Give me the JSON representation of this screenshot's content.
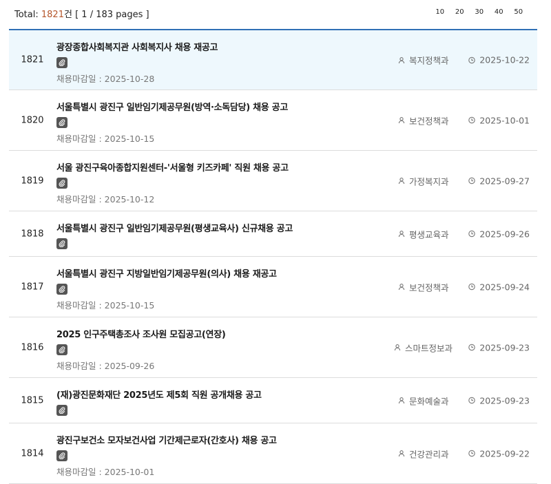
{
  "summary": {
    "total_label": "Total:",
    "count": "1821",
    "unit": "건",
    "pages": "[ 1 / 183 pages ]"
  },
  "page_sizes": [
    "10",
    "20",
    "30",
    "40",
    "50"
  ],
  "posts": [
    {
      "no": "1821",
      "title": "광장종합사회복지관 사회복지사 채용 재공고",
      "deadline": "채용마감일 : 2025-10-28",
      "dept": "복지정책과",
      "date": "2025-10-22",
      "highlight": true
    },
    {
      "no": "1820",
      "title": "서울특별시 광진구 일반임기제공무원(방역·소독담당) 채용 공고",
      "deadline": "채용마감일 : 2025-10-15",
      "dept": "보건정책과",
      "date": "2025-10-01",
      "highlight": false
    },
    {
      "no": "1819",
      "title": "서울 광진구육아종합지원센터-'서울형 키즈카페' 직원 채용 공고",
      "deadline": "채용마감일 : 2025-10-12",
      "dept": "가정복지과",
      "date": "2025-09-27",
      "highlight": false
    },
    {
      "no": "1818",
      "title": "서울특별시 광진구 일반임기제공무원(평생교육사) 신규채용 공고",
      "deadline": "",
      "dept": "평생교육과",
      "date": "2025-09-26",
      "highlight": false
    },
    {
      "no": "1817",
      "title": "서울특별시 광진구 지방일반임기제공무원(의사) 채용 재공고",
      "deadline": "채용마감일 : 2025-10-15",
      "dept": "보건정책과",
      "date": "2025-09-24",
      "highlight": false
    },
    {
      "no": "1816",
      "title": "2025 인구주택총조사 조사원 모집공고(연장)",
      "deadline": "채용마감일 : 2025-09-26",
      "dept": "스마트정보과",
      "date": "2025-09-23",
      "highlight": false
    },
    {
      "no": "1815",
      "title": "(재)광진문화재단 2025년도 제5회 직원 공개채용 공고",
      "deadline": "",
      "dept": "문화예술과",
      "date": "2025-09-23",
      "highlight": false
    },
    {
      "no": "1814",
      "title": "광진구보건소 모자보건사업 기간제근로자(간호사) 채용 공고",
      "deadline": "채용마감일 : 2025-10-01",
      "dept": "건강관리과",
      "date": "2025-09-22",
      "highlight": false
    }
  ]
}
